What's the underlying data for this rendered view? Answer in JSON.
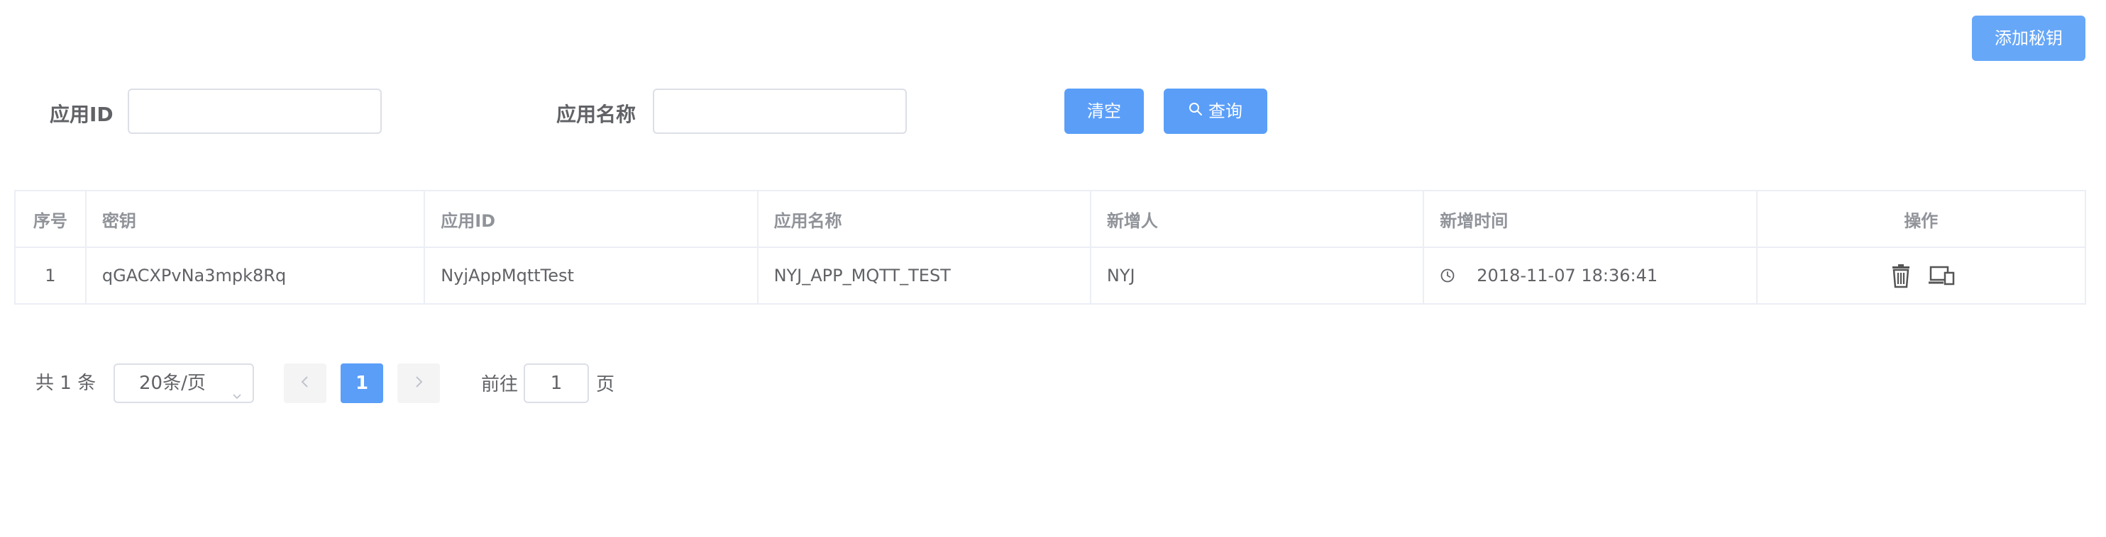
{
  "header": {
    "add_key_label": "添加秘钥"
  },
  "search": {
    "app_id_label": "应用ID",
    "app_id_value": "",
    "app_name_label": "应用名称",
    "app_name_value": "",
    "clear_label": "清空",
    "query_label": "查询",
    "query_icon": "search-icon"
  },
  "table": {
    "columns": [
      "序号",
      "密钥",
      "应用ID",
      "应用名称",
      "新增人",
      "新增时间",
      "操作"
    ],
    "rows": [
      {
        "index": "1",
        "key": "qGACXPvNa3mpk8Rq",
        "app_id": "NyjAppMqttTest",
        "app_name": "NYJ_APP_MQTT_TEST",
        "creator": "NYJ",
        "created_at": "2018-11-07 18:36:41",
        "time_icon": "clock-icon",
        "actions": [
          "delete-icon",
          "devices-icon"
        ]
      }
    ]
  },
  "pagination": {
    "total_label": "共 1 条",
    "page_size": "20条/页",
    "current_page": "1",
    "goto_prefix": "前往",
    "goto_value": "1",
    "goto_suffix": "页"
  },
  "colors": {
    "primary": "#5a9ef8",
    "add_button": "#66a7f8",
    "border": "#ebeef5",
    "text": "#606266",
    "header_text": "#909399"
  }
}
